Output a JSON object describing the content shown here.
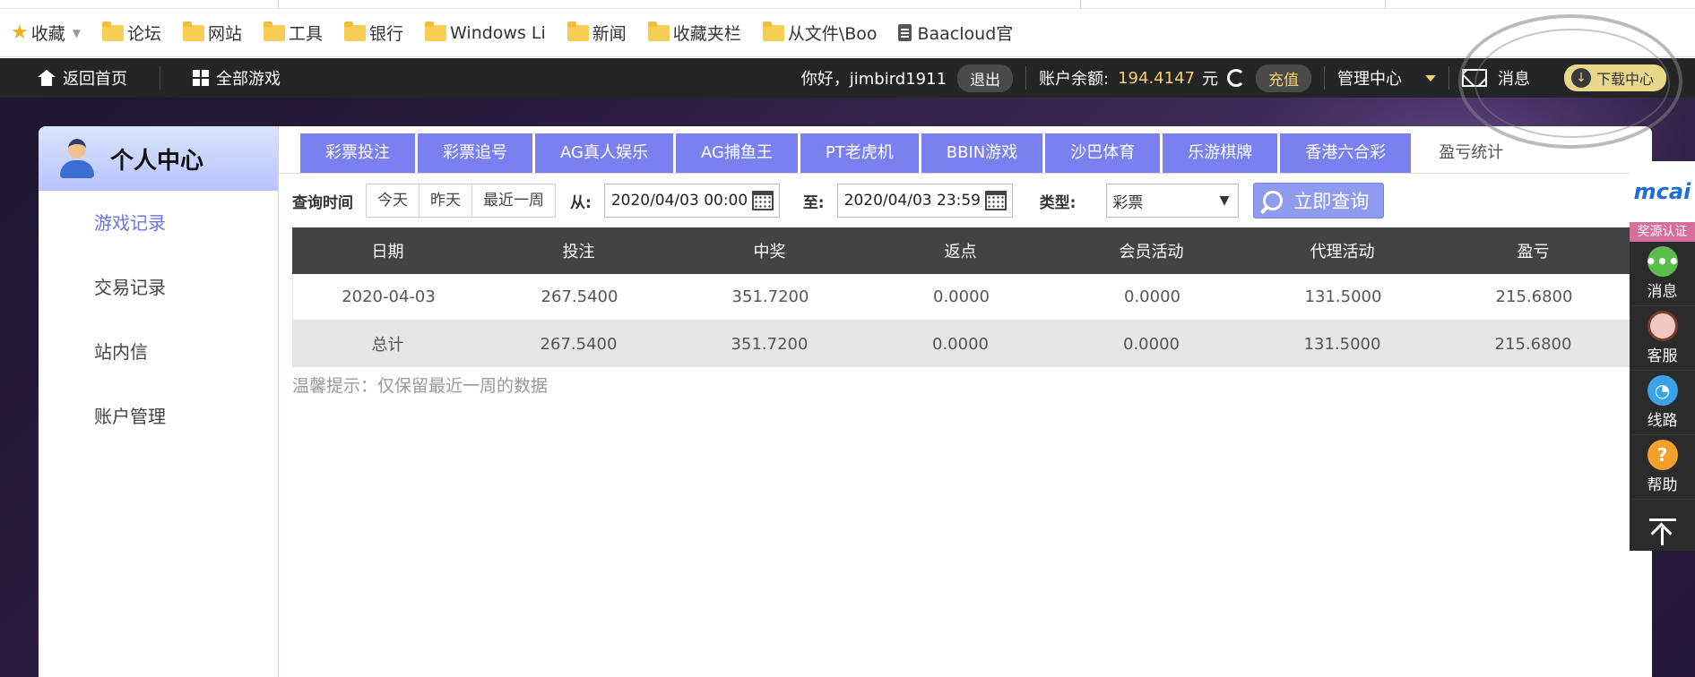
{
  "bookmarks": {
    "items": [
      {
        "label": "收藏",
        "icon": "star-icon"
      },
      {
        "label": "论坛",
        "icon": "folder-icon"
      },
      {
        "label": "网站",
        "icon": "folder-icon"
      },
      {
        "label": "工具",
        "icon": "folder-icon"
      },
      {
        "label": "银行",
        "icon": "folder-icon"
      },
      {
        "label": "Windows Li",
        "icon": "folder-icon"
      },
      {
        "label": "新闻",
        "icon": "folder-icon"
      },
      {
        "label": "收藏夹栏",
        "icon": "folder-icon"
      },
      {
        "label": "从文件\\Boo",
        "icon": "folder-icon"
      },
      {
        "label": "Baacloud官",
        "icon": "document-icon"
      }
    ]
  },
  "nav": {
    "home_label": "返回首页",
    "games_label": "全部游戏",
    "greeting": "你好，jimbird1911",
    "logout_label": "退出",
    "balance_label": "账户余额:",
    "balance_value": "194.4147",
    "balance_unit": "元",
    "recharge_label": "充值",
    "admin_label": "管理中心",
    "messages_label": "消息",
    "download_label": "下载中心"
  },
  "sidebar": {
    "title": "个人中心",
    "items": [
      {
        "label": "游戏记录",
        "active": true
      },
      {
        "label": "交易记录",
        "active": false
      },
      {
        "label": "站内信",
        "active": false
      },
      {
        "label": "账户管理",
        "active": false
      }
    ]
  },
  "tabs": [
    {
      "label": "彩票投注",
      "active": false
    },
    {
      "label": "彩票追号",
      "active": false
    },
    {
      "label": "AG真人娱乐",
      "active": false
    },
    {
      "label": "AG捕鱼王",
      "active": false
    },
    {
      "label": "PT老虎机",
      "active": false
    },
    {
      "label": "BBIN游戏",
      "active": false
    },
    {
      "label": "沙巴体育",
      "active": false
    },
    {
      "label": "乐游棋牌",
      "active": false
    },
    {
      "label": "香港六合彩",
      "active": false
    },
    {
      "label": "盈亏统计",
      "active": true
    }
  ],
  "query": {
    "time_label": "查询时间",
    "quick_ranges": [
      "今天",
      "昨天",
      "最近一周"
    ],
    "from_label": "从:",
    "from_value": "2020/04/03 00:00",
    "to_label": "至:",
    "to_value": "2020/04/03 23:59",
    "type_label": "类型:",
    "type_value": "彩票",
    "search_label": "立即查询"
  },
  "table": {
    "headers": [
      "日期",
      "投注",
      "中奖",
      "返点",
      "会员活动",
      "代理活动",
      "盈亏"
    ],
    "rows": [
      [
        "2020-04-03",
        "267.5400",
        "351.7200",
        "0.0000",
        "0.0000",
        "131.5000",
        "215.6800"
      ]
    ],
    "total": [
      "总计",
      "267.5400",
      "351.7200",
      "0.0000",
      "0.0000",
      "131.5000",
      "215.6800"
    ]
  },
  "tip": "温馨提示：仅保留最近一周的数据",
  "rail": {
    "brand": "mcai",
    "badge": "奖源认证",
    "items": [
      {
        "label": "消息",
        "icon": "chat-bubble-icon"
      },
      {
        "label": "客服",
        "icon": "support-agent-icon"
      },
      {
        "label": "线路",
        "icon": "speed-gauge-icon"
      },
      {
        "label": "帮助",
        "icon": "help-icon"
      }
    ]
  },
  "colors": {
    "accent_tab": "#7a80f0",
    "gold": "#f5d36a",
    "navbar": "#252525",
    "table_head": "#434343"
  }
}
